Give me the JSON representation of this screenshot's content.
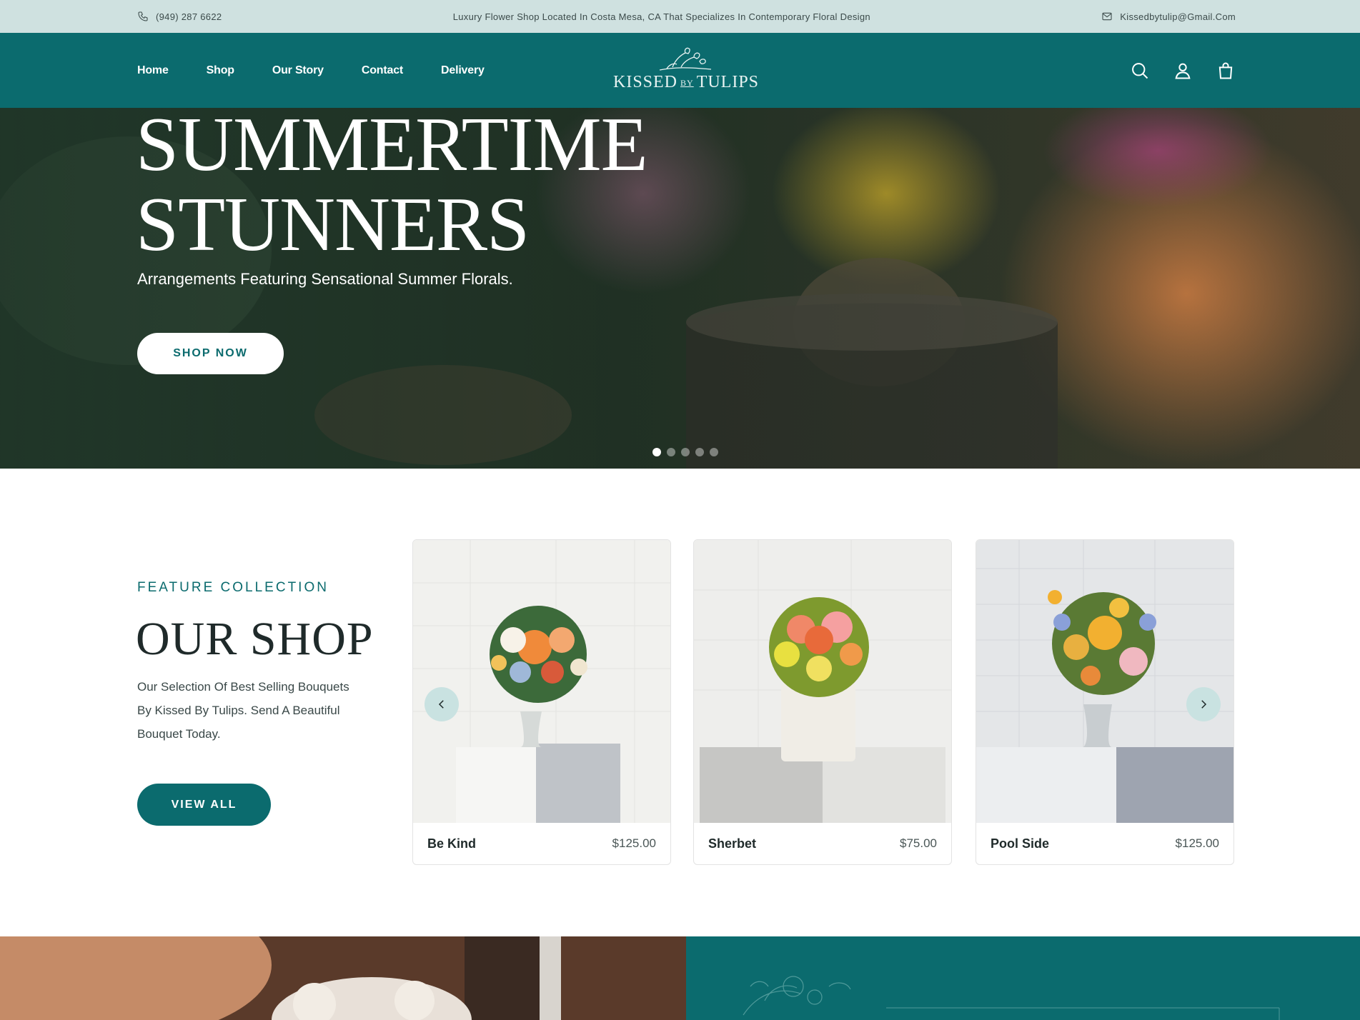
{
  "topbar": {
    "phone": "(949) 287 6622",
    "tagline": "Luxury Flower Shop Located In Costa Mesa, CA That Specializes In Contemporary Floral Design",
    "email": "Kissedbytulip@Gmail.Com"
  },
  "nav": {
    "items": [
      {
        "label": "Home"
      },
      {
        "label": "Shop"
      },
      {
        "label": "Our Story"
      },
      {
        "label": "Contact"
      },
      {
        "label": "Delivery"
      }
    ]
  },
  "logo": {
    "left": "KISSED",
    "middle": "BY",
    "right": "TULIPS"
  },
  "hero": {
    "title_line1": "SUMMERTIME",
    "title_line2": "STUNNERS",
    "subtitle": "Arrangements Featuring Sensational Summer Florals.",
    "cta": "SHOP NOW",
    "slide_count": 5,
    "active_slide": 1
  },
  "feature": {
    "eyebrow": "FEATURE COLLECTION",
    "title": "OUR SHOP",
    "description": "Our Selection Of Best Selling Bouquets By Kissed By Tulips. Send A Beautiful Bouquet Today.",
    "cta": "VIEW ALL"
  },
  "products": [
    {
      "name": "Be Kind",
      "price": "$125.00"
    },
    {
      "name": "Sherbet",
      "price": "$75.00"
    },
    {
      "name": "Pool Side",
      "price": "$125.00"
    }
  ],
  "colors": {
    "brand": "#0b6b6e",
    "topbar": "#cfe1e0",
    "arrow": "#c9e2e1"
  },
  "icons": {
    "phone": "phone-icon",
    "email": "mail-icon",
    "search": "search-icon",
    "account": "user-icon",
    "cart": "bag-icon",
    "prev": "chevron-left-icon",
    "next": "chevron-right-icon"
  }
}
